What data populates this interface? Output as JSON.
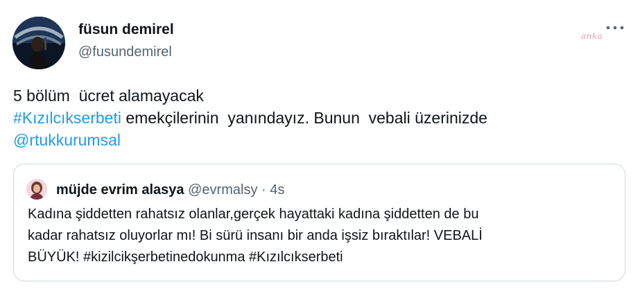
{
  "tweet": {
    "author": {
      "display_name": "füsun demirel",
      "handle": "@fusundemirel",
      "avatar_icon": "profile-photo"
    },
    "watermark_text": "anka",
    "more_icon": "more-horizontal-icon",
    "text": {
      "line1": "5 bölüm  ücret alamayacak",
      "line2_hashtag": "#Kızılcıkserbeti",
      "line2_rest": " emekçilerinin  yanındayız. Bunun  vebali üzerinizde",
      "line3_mention": "@rtukkurumsal"
    },
    "quoted": {
      "display_name": "müjde evrim alasya",
      "handle": "@evrmalsy",
      "separator": "·",
      "time": "4s",
      "text": {
        "line1": "Kadına şiddetten rahatsız olanlar,gerçek hayattaki kadına şiddetten de bu",
        "line2": "kadar rahatsız oluyorlar mı! Bi sürü insanı bir anda işsiz bıraktılar! VEBALİ",
        "line3": "BÜYÜK! #kizilcikşerbetinedokunma #Kızılcıkserbeti"
      }
    },
    "colors": {
      "link": "#1d9bf0",
      "secondary_text": "#536471",
      "border": "#cfd9de"
    }
  }
}
